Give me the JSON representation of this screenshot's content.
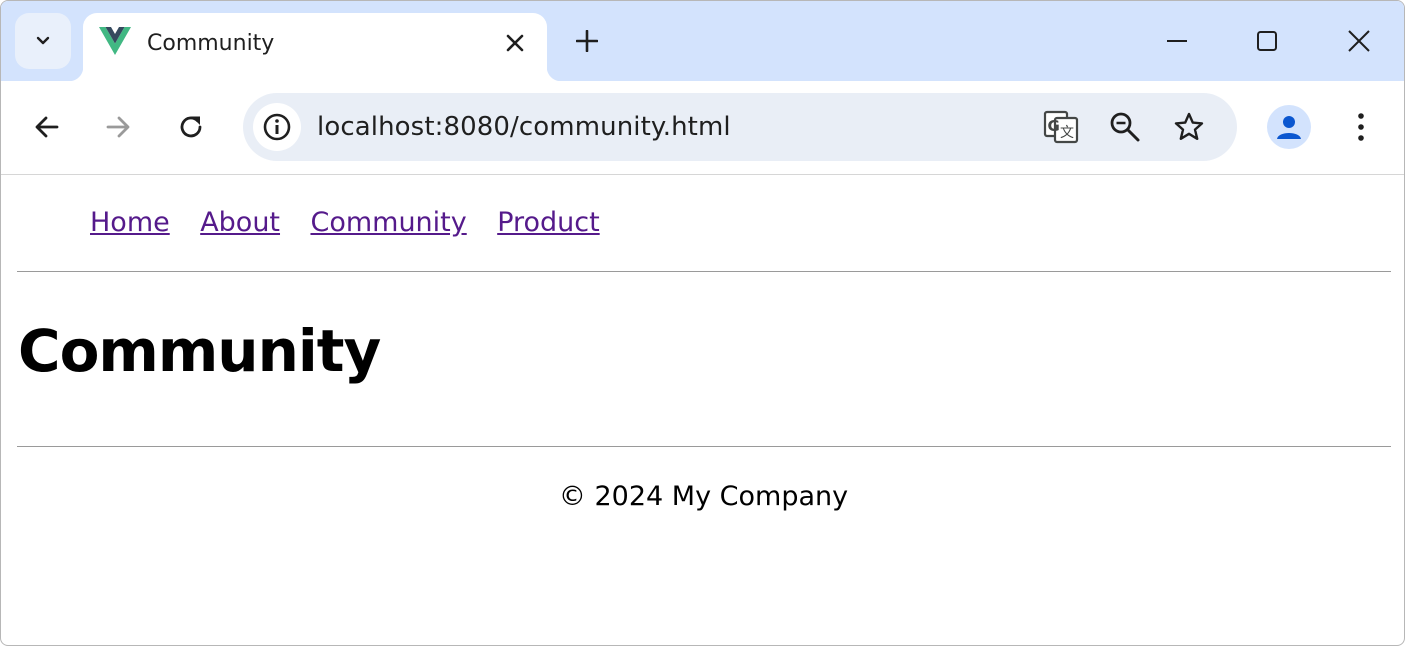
{
  "browser": {
    "tab": {
      "title": "Community",
      "favicon": "vue-logo-icon"
    },
    "url": "localhost:8080/community.html",
    "colors": {
      "tabstrip": "#d3e3fd",
      "omnibox": "#e9eef6",
      "avatar": "#0b57d0",
      "vue_green": "#41b883",
      "vue_dark": "#35495e"
    }
  },
  "page": {
    "nav": {
      "items": [
        {
          "label": "Home"
        },
        {
          "label": "About"
        },
        {
          "label": "Community"
        },
        {
          "label": "Product"
        }
      ],
      "link_color": "#551a8b"
    },
    "title": "Community",
    "footer": {
      "text": "© 2024 My Company"
    }
  }
}
